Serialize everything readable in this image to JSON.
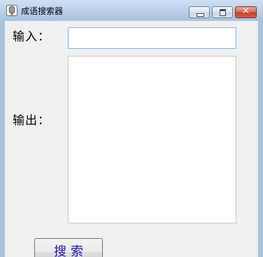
{
  "window": {
    "title": "成语搜索器"
  },
  "form": {
    "input_label": "输入：",
    "input_value": "",
    "input_placeholder": "",
    "output_label": "输出：",
    "output_value": "",
    "search_button_label": "搜索"
  },
  "icons": {
    "app": "tree-icon",
    "minimize": "minimize-icon",
    "maximize": "maximize-icon",
    "close": "close-icon"
  },
  "colors": {
    "titlebar": "#bcd3ea",
    "client_bg": "#f0f0f0",
    "button_text": "#1a1ab0",
    "close_button": "#c7402b",
    "input_border_focus": "#7eb4ea"
  }
}
